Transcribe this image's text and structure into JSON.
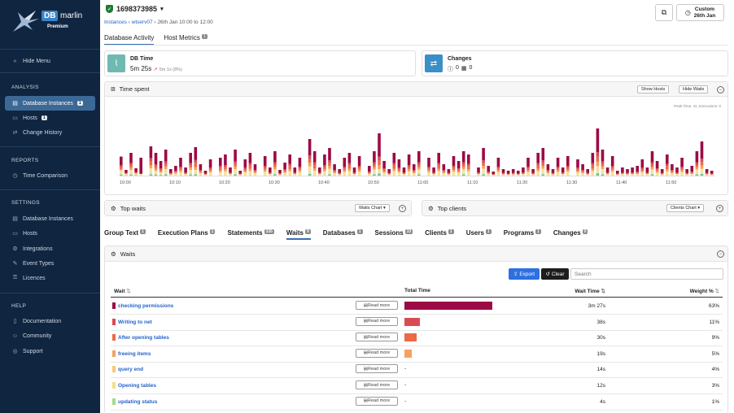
{
  "brand": {
    "db": "DB",
    "marlin": "marlin",
    "edition": "Premium"
  },
  "sidebar": {
    "hide_menu": "Hide Menu",
    "sections": [
      {
        "heading": "ANALYSIS",
        "items": [
          {
            "label": "Database Instances",
            "badge": "1",
            "icon": "database-icon",
            "active": true
          },
          {
            "label": "Hosts",
            "badge": "1",
            "icon": "host-icon"
          },
          {
            "label": "Change History",
            "icon": "swap-icon"
          }
        ]
      },
      {
        "heading": "REPORTS",
        "items": [
          {
            "label": "Time Comparison",
            "icon": "clock-icon"
          }
        ]
      },
      {
        "heading": "SETTINGS",
        "items": [
          {
            "label": "Database Instances",
            "icon": "database-icon"
          },
          {
            "label": "Hosts",
            "icon": "host-icon"
          },
          {
            "label": "Integrations",
            "icon": "integration-icon"
          },
          {
            "label": "Event Types",
            "icon": "event-icon"
          },
          {
            "label": "Licences",
            "icon": "licence-icon"
          }
        ]
      },
      {
        "heading": "HELP",
        "items": [
          {
            "label": "Documentation",
            "icon": "book-icon"
          },
          {
            "label": "Community",
            "icon": "community-icon"
          },
          {
            "label": "Support",
            "icon": "support-icon"
          }
        ]
      }
    ]
  },
  "header": {
    "instance_id": "1698373985",
    "breadcrumb": {
      "root": "Instances",
      "server": "wtserv07",
      "range": "26th Jan 10:00 to 12:00"
    },
    "date_button": {
      "line1": "Custom",
      "line2": "26th Jan"
    }
  },
  "main_tabs": [
    {
      "label": "Database Activity",
      "active": true
    },
    {
      "label": "Host Metrics",
      "badge": "1"
    }
  ],
  "db_time": {
    "title": "DB Time",
    "value": "5m 25s",
    "delta": "5m 1s (8%)"
  },
  "changes": {
    "title": "Changes",
    "count1": "0",
    "count2": "0"
  },
  "time_spent": {
    "title": "Time spent",
    "show_hosts": "Show Hosts",
    "hide_waits": "Hide Waits",
    "peak_label": "Peak Time: 4s, Executions: 0"
  },
  "top_waits": {
    "title": "Top waits",
    "button": "Waits Chart"
  },
  "top_clients": {
    "title": "Top clients",
    "button": "Clients Chart"
  },
  "analysis_tabs": [
    {
      "label": "Group Text",
      "badge": "1"
    },
    {
      "label": "Execution Plans",
      "badge": "1"
    },
    {
      "label": "Statements",
      "badge": "335"
    },
    {
      "label": "Waits",
      "badge": "9",
      "active": true
    },
    {
      "label": "Databases",
      "badge": "1"
    },
    {
      "label": "Sessions",
      "badge": "33"
    },
    {
      "label": "Clients",
      "badge": "1"
    },
    {
      "label": "Users",
      "badge": "1"
    },
    {
      "label": "Programs",
      "badge": "1"
    },
    {
      "label": "Changes",
      "badge": "0"
    }
  ],
  "waits_panel": {
    "title": "Waits",
    "export": "Export",
    "clear": "Clear",
    "search_placeholder": "Search",
    "columns": {
      "wait": "Wait",
      "total_time": "Total Time",
      "wait_time": "Wait Time",
      "weight": "Weight %"
    },
    "read_more": "Read more",
    "rows": [
      {
        "name": "checking permissions",
        "color": "#9c0a45",
        "wait_time": "3m 27s",
        "weight": "63%",
        "bar": 0.63
      },
      {
        "name": "Writing to net",
        "color": "#d94a55",
        "wait_time": "38s",
        "weight": "11%",
        "bar": 0.11
      },
      {
        "name": "After opening tables",
        "color": "#ea6b45",
        "wait_time": "30s",
        "weight": "9%",
        "bar": 0.09
      },
      {
        "name": "freeing items",
        "color": "#f4a261",
        "wait_time": "19s",
        "weight": "5%",
        "bar": 0.05
      },
      {
        "name": "query end",
        "color": "#f6c97a",
        "wait_time": "14s",
        "weight": "4%",
        "bar": 0,
        "dash": "-"
      },
      {
        "name": "Opening tables",
        "color": "#f3e287",
        "wait_time": "12s",
        "weight": "3%",
        "bar": 0,
        "dash": "-"
      },
      {
        "name": "updating status",
        "color": "#a8d98e",
        "wait_time": "4s",
        "weight": "1%",
        "bar": 0,
        "dash": "-"
      }
    ]
  },
  "chart_data": {
    "type": "bar",
    "stacked": true,
    "x_ticks": [
      "10:00",
      "10:10",
      "10:20",
      "10:30",
      "10:40",
      "10:50",
      "11:00",
      "11:10",
      "11:20",
      "11:30",
      "11:40",
      "11:50"
    ],
    "x_range_minutes": [
      0,
      120
    ],
    "series_colors": [
      "#9c0a45",
      "#d94a55",
      "#ea6b45",
      "#f4a261",
      "#f6e1a0",
      "#6cc3a6"
    ],
    "bars": [
      [
        0,
        26,
        0.4,
        0.1,
        0.1,
        0.05,
        0.2,
        0.05
      ],
      [
        1,
        7,
        0.5,
        0.1,
        0.1,
        0.05,
        0.2,
        0.05
      ],
      [
        2,
        28,
        0.45,
        0.1,
        0.1,
        0.1,
        0.2,
        0.05
      ],
      [
        3,
        9,
        0.5,
        0.1,
        0.1,
        0.05,
        0.2,
        0.05
      ],
      [
        4,
        22,
        0.9,
        0,
        0,
        0,
        0.1,
        0
      ],
      [
        6,
        36,
        0.4,
        0.1,
        0.15,
        0.1,
        0.2,
        0.05
      ],
      [
        7,
        28,
        0.5,
        0.1,
        0.1,
        0.1,
        0.15,
        0.05
      ],
      [
        8,
        18,
        0.5,
        0.1,
        0.1,
        0.1,
        0.15,
        0.05
      ],
      [
        9,
        32,
        0.45,
        0.1,
        0.1,
        0.1,
        0.2,
        0.05
      ],
      [
        10,
        8,
        0.6,
        0.1,
        0.1,
        0,
        0.2,
        0
      ],
      [
        11,
        12,
        0.5,
        0.1,
        0.1,
        0.1,
        0.2,
        0
      ],
      [
        12,
        22,
        0.5,
        0.1,
        0.1,
        0.1,
        0.2,
        0
      ],
      [
        13,
        10,
        0.6,
        0.1,
        0.1,
        0,
        0.2,
        0
      ],
      [
        14,
        28,
        0.45,
        0.1,
        0.1,
        0.1,
        0.2,
        0.05
      ],
      [
        15,
        35,
        0.45,
        0.1,
        0.15,
        0.1,
        0.15,
        0.05
      ],
      [
        16,
        14,
        0.5,
        0.1,
        0.1,
        0.1,
        0.2,
        0
      ],
      [
        17,
        6,
        0.6,
        0.1,
        0.1,
        0,
        0.2,
        0
      ],
      [
        18,
        20,
        0.5,
        0.1,
        0.1,
        0.1,
        0.2,
        0
      ],
      [
        20,
        22,
        0.45,
        0.1,
        0.15,
        0.1,
        0.2,
        0
      ],
      [
        21,
        26,
        0.5,
        0.1,
        0.1,
        0.1,
        0.2,
        0
      ],
      [
        22,
        10,
        0.6,
        0.1,
        0.1,
        0,
        0.2,
        0
      ],
      [
        23,
        32,
        0.45,
        0.1,
        0.1,
        0.1,
        0.2,
        0.05
      ],
      [
        24,
        6,
        0.6,
        0.1,
        0.1,
        0,
        0.2,
        0
      ],
      [
        25,
        20,
        0.5,
        0.1,
        0.1,
        0.1,
        0.2,
        0
      ],
      [
        26,
        28,
        0.45,
        0.1,
        0.15,
        0.1,
        0.2,
        0
      ],
      [
        27,
        14,
        0.5,
        0.1,
        0.1,
        0.1,
        0.2,
        0
      ],
      [
        29,
        24,
        0.5,
        0.1,
        0.1,
        0.1,
        0.2,
        0
      ],
      [
        30,
        10,
        0.6,
        0.1,
        0.1,
        0,
        0.2,
        0
      ],
      [
        31,
        30,
        0.45,
        0.1,
        0.1,
        0.1,
        0.2,
        0.05
      ],
      [
        32,
        7,
        0.6,
        0.1,
        0.1,
        0,
        0.2,
        0
      ],
      [
        33,
        16,
        0.5,
        0.1,
        0.1,
        0.1,
        0.2,
        0
      ],
      [
        34,
        26,
        0.45,
        0.1,
        0.15,
        0.1,
        0.2,
        0
      ],
      [
        35,
        10,
        0.6,
        0.1,
        0.1,
        0,
        0.2,
        0
      ],
      [
        36,
        22,
        0.5,
        0.1,
        0.1,
        0.1,
        0.2,
        0
      ],
      [
        38,
        45,
        0.45,
        0.1,
        0.1,
        0.1,
        0.2,
        0.05
      ],
      [
        39,
        30,
        0.45,
        0.1,
        0.15,
        0.1,
        0.2,
        0
      ],
      [
        40,
        10,
        0.6,
        0.1,
        0.1,
        0,
        0.2,
        0
      ],
      [
        41,
        26,
        0.5,
        0.1,
        0.1,
        0.1,
        0.2,
        0
      ],
      [
        42,
        34,
        0.45,
        0.1,
        0.1,
        0.1,
        0.2,
        0.05
      ],
      [
        43,
        14,
        0.5,
        0.1,
        0.1,
        0.1,
        0.2,
        0
      ],
      [
        44,
        8,
        0.6,
        0.1,
        0.1,
        0,
        0.2,
        0
      ],
      [
        45,
        22,
        0.5,
        0.1,
        0.1,
        0.1,
        0.2,
        0
      ],
      [
        46,
        28,
        0.45,
        0.1,
        0.15,
        0.1,
        0.2,
        0
      ],
      [
        47,
        10,
        0.6,
        0.1,
        0.1,
        0,
        0.2,
        0
      ],
      [
        48,
        24,
        0.5,
        0.1,
        0.1,
        0.1,
        0.2,
        0
      ],
      [
        50,
        12,
        0.6,
        0.1,
        0.1,
        0,
        0.2,
        0
      ],
      [
        51,
        30,
        0.45,
        0.1,
        0.1,
        0.1,
        0.2,
        0.05
      ],
      [
        52,
        52,
        0.55,
        0.1,
        0.1,
        0.1,
        0.1,
        0.05
      ],
      [
        53,
        18,
        0.5,
        0.1,
        0.1,
        0.1,
        0.2,
        0
      ],
      [
        54,
        8,
        0.6,
        0.1,
        0.1,
        0,
        0.2,
        0
      ],
      [
        55,
        28,
        0.45,
        0.1,
        0.15,
        0.1,
        0.2,
        0
      ],
      [
        56,
        20,
        0.5,
        0.1,
        0.1,
        0.1,
        0.2,
        0
      ],
      [
        57,
        10,
        0.6,
        0.1,
        0.1,
        0,
        0.2,
        0
      ],
      [
        58,
        26,
        0.5,
        0.1,
        0.1,
        0.1,
        0.2,
        0
      ],
      [
        59,
        14,
        0.5,
        0.1,
        0.1,
        0.1,
        0.2,
        0
      ],
      [
        60,
        30,
        0.45,
        0.1,
        0.1,
        0.1,
        0.2,
        0.05
      ],
      [
        62,
        22,
        0.5,
        0.1,
        0.1,
        0.1,
        0.2,
        0
      ],
      [
        63,
        10,
        0.6,
        0.1,
        0.1,
        0,
        0.2,
        0
      ],
      [
        64,
        28,
        0.45,
        0.1,
        0.15,
        0.1,
        0.2,
        0
      ],
      [
        65,
        14,
        0.5,
        0.1,
        0.1,
        0.1,
        0.2,
        0
      ],
      [
        66,
        8,
        0.6,
        0.1,
        0.1,
        0,
        0.2,
        0
      ],
      [
        67,
        24,
        0.5,
        0.1,
        0.1,
        0.1,
        0.2,
        0
      ],
      [
        68,
        18,
        0.5,
        0.1,
        0.1,
        0.1,
        0.2,
        0
      ],
      [
        69,
        30,
        0.45,
        0.1,
        0.1,
        0.1,
        0.2,
        0.05
      ],
      [
        70,
        26,
        0.45,
        0.1,
        0.15,
        0.1,
        0.2,
        0
      ],
      [
        72,
        10,
        0.6,
        0.1,
        0.1,
        0,
        0.2,
        0
      ],
      [
        73,
        34,
        0.45,
        0.1,
        0.1,
        0.1,
        0.2,
        0.05
      ],
      [
        74,
        12,
        0.6,
        0.1,
        0.1,
        0,
        0.2,
        0
      ],
      [
        75,
        5,
        0.6,
        0.1,
        0.1,
        0,
        0.2,
        0
      ],
      [
        76,
        22,
        0.5,
        0.1,
        0.1,
        0.1,
        0.2,
        0
      ],
      [
        77,
        8,
        0.6,
        0.1,
        0.1,
        0,
        0.2,
        0
      ],
      [
        78,
        6,
        0.6,
        0.1,
        0.1,
        0,
        0.2,
        0
      ],
      [
        79,
        8,
        0.6,
        0.1,
        0.1,
        0,
        0.2,
        0
      ],
      [
        80,
        6,
        0.6,
        0.1,
        0.1,
        0,
        0.2,
        0
      ],
      [
        81,
        10,
        0.6,
        0.1,
        0.1,
        0,
        0.2,
        0
      ],
      [
        82,
        22,
        0.5,
        0.1,
        0.1,
        0.1,
        0.2,
        0
      ],
      [
        83,
        8,
        0.6,
        0.1,
        0.1,
        0,
        0.2,
        0
      ],
      [
        84,
        28,
        0.45,
        0.1,
        0.15,
        0.1,
        0.2,
        0
      ],
      [
        85,
        34,
        0.45,
        0.1,
        0.1,
        0.1,
        0.2,
        0.05
      ],
      [
        86,
        14,
        0.5,
        0.1,
        0.1,
        0.1,
        0.2,
        0
      ],
      [
        87,
        8,
        0.6,
        0.1,
        0.1,
        0,
        0.2,
        0
      ],
      [
        88,
        22,
        0.5,
        0.1,
        0.1,
        0.1,
        0.2,
        0
      ],
      [
        89,
        10,
        0.6,
        0.1,
        0.1,
        0,
        0.2,
        0
      ],
      [
        90,
        24,
        0.5,
        0.1,
        0.1,
        0.1,
        0.2,
        0
      ],
      [
        92,
        20,
        0.5,
        0.1,
        0.1,
        0.1,
        0.2,
        0
      ],
      [
        93,
        14,
        0.5,
        0.1,
        0.1,
        0.1,
        0.2,
        0
      ],
      [
        94,
        8,
        0.6,
        0.1,
        0.1,
        0,
        0.2,
        0
      ],
      [
        95,
        28,
        0.45,
        0.1,
        0.15,
        0.1,
        0.2,
        0
      ],
      [
        96,
        58,
        0.5,
        0.1,
        0.1,
        0.1,
        0.15,
        0.05
      ],
      [
        97,
        32,
        0.45,
        0.1,
        0.1,
        0.1,
        0.2,
        0.05
      ],
      [
        98,
        10,
        0.6,
        0.1,
        0.1,
        0,
        0.2,
        0
      ],
      [
        99,
        24,
        0.5,
        0.1,
        0.1,
        0.1,
        0.2,
        0
      ],
      [
        100,
        6,
        0.6,
        0.1,
        0.1,
        0,
        0.2,
        0
      ],
      [
        101,
        10,
        0.6,
        0.1,
        0.1,
        0,
        0.2,
        0
      ],
      [
        102,
        8,
        0.6,
        0.1,
        0.1,
        0,
        0.2,
        0
      ],
      [
        103,
        10,
        0.6,
        0.1,
        0.1,
        0,
        0.2,
        0
      ],
      [
        104,
        12,
        0.6,
        0.1,
        0.1,
        0,
        0.2,
        0
      ],
      [
        105,
        20,
        0.5,
        0.1,
        0.1,
        0.1,
        0.2,
        0
      ],
      [
        106,
        10,
        0.6,
        0.1,
        0.1,
        0,
        0.2,
        0
      ],
      [
        107,
        30,
        0.45,
        0.1,
        0.1,
        0.1,
        0.2,
        0.05
      ],
      [
        108,
        18,
        0.5,
        0.1,
        0.1,
        0.1,
        0.2,
        0
      ],
      [
        109,
        8,
        0.6,
        0.1,
        0.1,
        0,
        0.2,
        0
      ],
      [
        110,
        26,
        0.45,
        0.1,
        0.15,
        0.1,
        0.2,
        0
      ],
      [
        111,
        14,
        0.5,
        0.1,
        0.1,
        0.1,
        0.2,
        0
      ],
      [
        112,
        10,
        0.6,
        0.1,
        0.1,
        0,
        0.2,
        0
      ],
      [
        113,
        22,
        0.5,
        0.1,
        0.1,
        0.1,
        0.2,
        0
      ],
      [
        114,
        8,
        0.6,
        0.1,
        0.1,
        0,
        0.2,
        0
      ],
      [
        115,
        12,
        0.6,
        0.1,
        0.1,
        0,
        0.2,
        0
      ],
      [
        116,
        30,
        0.45,
        0.1,
        0.1,
        0.1,
        0.2,
        0.05
      ],
      [
        117,
        42,
        0.5,
        0.1,
        0.1,
        0.1,
        0.15,
        0.05
      ],
      [
        118,
        8,
        0.6,
        0.1,
        0.1,
        0,
        0.2,
        0
      ],
      [
        119,
        6,
        0.6,
        0.1,
        0.1,
        0,
        0.2,
        0
      ]
    ]
  }
}
